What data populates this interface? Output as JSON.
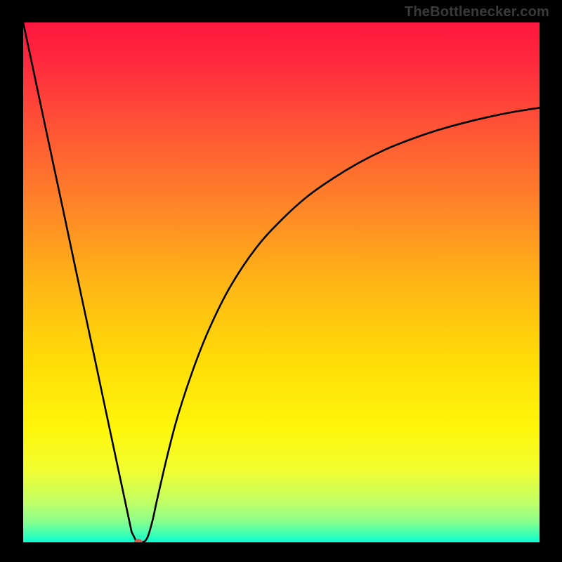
{
  "chart_data": {
    "type": "line",
    "title": "",
    "xlabel": "",
    "ylabel": "",
    "xlim": [
      0,
      100
    ],
    "ylim": [
      0,
      100
    ],
    "grid": false,
    "x": [
      0,
      2,
      4,
      6,
      8,
      10,
      12,
      14,
      16,
      18,
      20,
      21,
      22,
      23,
      24,
      25,
      26,
      28,
      30,
      33,
      36,
      40,
      45,
      50,
      55,
      60,
      65,
      70,
      75,
      80,
      85,
      90,
      95,
      100
    ],
    "values": [
      100,
      90.7,
      81.3,
      72.0,
      62.7,
      53.3,
      44.0,
      34.7,
      25.3,
      16.0,
      6.7,
      2.0,
      0.0,
      0.0,
      0.8,
      4.0,
      8.5,
      17.0,
      24.5,
      33.5,
      41.0,
      49.0,
      56.5,
      62.0,
      66.5,
      70.0,
      73.0,
      75.5,
      77.5,
      79.2,
      80.6,
      81.8,
      82.8,
      83.6
    ],
    "notch_marker": {
      "x": 22.3,
      "y": 0.0
    },
    "background_gradient": {
      "stops": [
        {
          "offset": 0.0,
          "color": "#ff173f"
        },
        {
          "offset": 0.08,
          "color": "#ff2b3e"
        },
        {
          "offset": 0.2,
          "color": "#ff5336"
        },
        {
          "offset": 0.35,
          "color": "#ff8428"
        },
        {
          "offset": 0.5,
          "color": "#ffb516"
        },
        {
          "offset": 0.65,
          "color": "#ffdc08"
        },
        {
          "offset": 0.78,
          "color": "#fff60b"
        },
        {
          "offset": 0.86,
          "color": "#f1fe30"
        },
        {
          "offset": 0.92,
          "color": "#c4ff62"
        },
        {
          "offset": 0.96,
          "color": "#8bff8e"
        },
        {
          "offset": 0.985,
          "color": "#3affb5"
        },
        {
          "offset": 1.0,
          "color": "#0affd4"
        }
      ]
    }
  },
  "watermark": "TheBottlenecker.com",
  "marker_color": "#d65a49",
  "curve_color": "#000000",
  "curve_width": 2.6
}
